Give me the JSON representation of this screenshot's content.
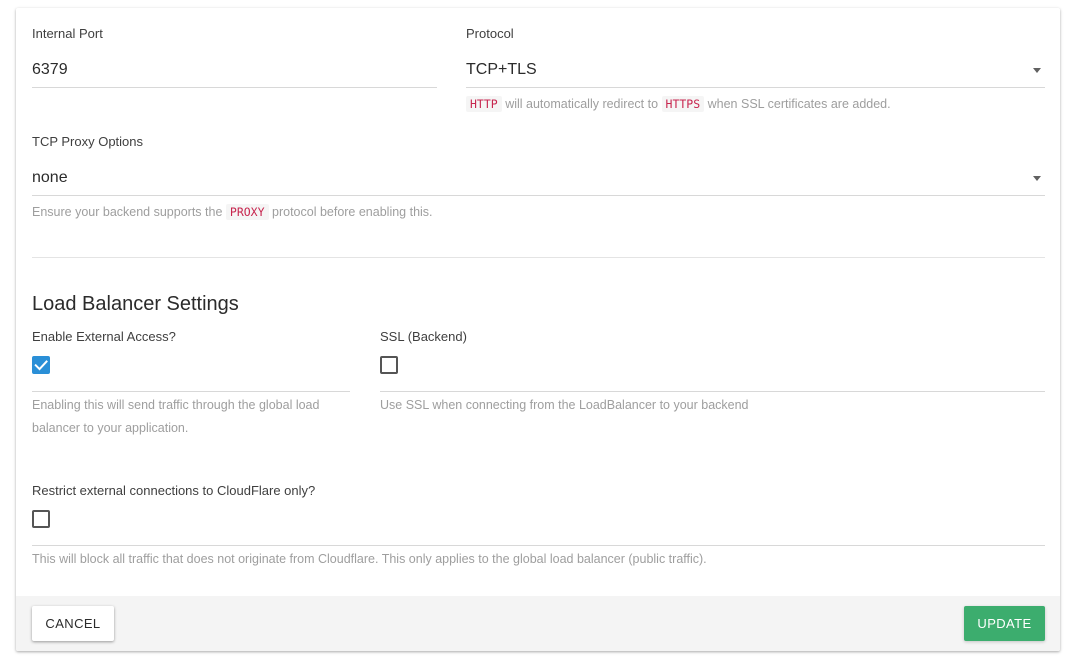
{
  "internal_port": {
    "label": "Internal Port",
    "value": "6379"
  },
  "protocol": {
    "label": "Protocol",
    "value": "TCP+TLS",
    "hint_code_1": "HTTP",
    "hint_mid": "will automatically redirect to",
    "hint_code_2": "HTTPS",
    "hint_end": "when SSL certificates are added."
  },
  "tcp_proxy": {
    "label": "TCP Proxy Options",
    "value": "none",
    "hint_start": "Ensure your backend supports the",
    "hint_code": "PROXY",
    "hint_end": "protocol before enabling this."
  },
  "load_balancer": {
    "title": "Load Balancer Settings",
    "external_access": {
      "label": "Enable External Access?",
      "checked": true,
      "hint_line1": "Enabling this will send traffic through the global load",
      "hint_line2": "balancer to your application."
    },
    "ssl_backend": {
      "label": "SSL (Backend)",
      "checked": false,
      "hint": "Use SSL when connecting from the LoadBalancer to your backend"
    },
    "cloudflare": {
      "label": "Restrict external connections to CloudFlare only?",
      "checked": false,
      "hint": "This will block all traffic that does not originate from Cloudflare. This only applies to the global load balancer (public traffic)."
    }
  },
  "footer": {
    "cancel_label": "Cancel",
    "update_label": "Update"
  },
  "colors": {
    "checkbox_checked": "#2a8fd7",
    "update_button": "#3cad6e",
    "code_text": "#c7254e"
  }
}
